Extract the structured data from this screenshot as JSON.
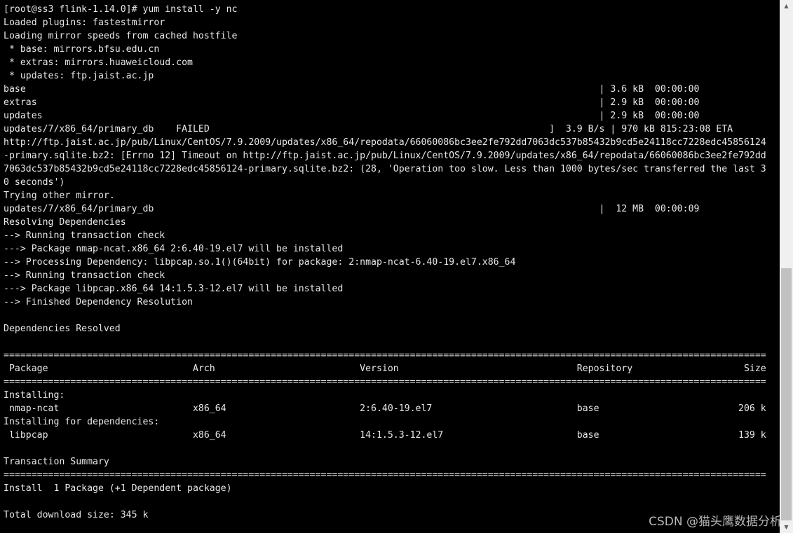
{
  "terminal": {
    "lines": [
      "[root@ss3 flink-1.14.0]# yum install -y nc",
      "Loaded plugins: fastestmirror",
      "Loading mirror speeds from cached hostfile",
      " * base: mirrors.bfsu.edu.cn",
      " * extras: mirrors.huaweicloud.com",
      " * updates: ftp.jaist.ac.jp",
      "base                                                                                                       | 3.6 kB  00:00:00",
      "extras                                                                                                     | 2.9 kB  00:00:00",
      "updates                                                                                                    | 2.9 kB  00:00:00",
      "updates/7/x86_64/primary_db    FAILED                                                             ]  3.9 B/s | 970 kB 815:23:08 ETA",
      "http://ftp.jaist.ac.jp/pub/Linux/CentOS/7.9.2009/updates/x86_64/repodata/66060086bc3ee2fe792dd7063dc537b85432b9cd5e24118cc7228edc45856124",
      "-primary.sqlite.bz2: [Errno 12] Timeout on http://ftp.jaist.ac.jp/pub/Linux/CentOS/7.9.2009/updates/x86_64/repodata/66060086bc3ee2fe792dd",
      "7063dc537b85432b9cd5e24118cc7228edc45856124-primary.sqlite.bz2: (28, 'Operation too slow. Less than 1000 bytes/sec transferred the last 3",
      "0 seconds')",
      "Trying other mirror.",
      "updates/7/x86_64/primary_db                                                                                |  12 MB  00:00:09",
      "Resolving Dependencies",
      "--> Running transaction check",
      "---> Package nmap-ncat.x86_64 2:6.40-19.el7 will be installed",
      "--> Processing Dependency: libpcap.so.1()(64bit) for package: 2:nmap-ncat-6.40-19.el7.x86_64",
      "--> Running transaction check",
      "---> Package libpcap.x86_64 14:1.5.3-12.el7 will be installed",
      "--> Finished Dependency Resolution",
      "",
      "Dependencies Resolved",
      "",
      "=========================================================================================================================================",
      " Package                          Arch                          Version                                Repository                    Size",
      "=========================================================================================================================================",
      "Installing:",
      " nmap-ncat                        x86_64                        2:6.40-19.el7                          base                         206 k",
      "Installing for dependencies:",
      " libpcap                          x86_64                        14:1.5.3-12.el7                        base                         139 k",
      "",
      "Transaction Summary",
      "=========================================================================================================================================",
      "Install  1 Package (+1 Dependent package)",
      "",
      "Total download size: 345 k"
    ]
  },
  "scrollbar": {
    "up_icon": "scroll-up-arrow",
    "down_icon": "scroll-down-arrow",
    "position_fraction": 0.55
  },
  "watermark": {
    "text": "CSDN @猫头鹰数据分析"
  },
  "colors": {
    "background": "#000000",
    "text": "#e8e8e8",
    "scrollbar_track": "#f0f0f0",
    "scrollbar_thumb": "#c1c1c1"
  }
}
